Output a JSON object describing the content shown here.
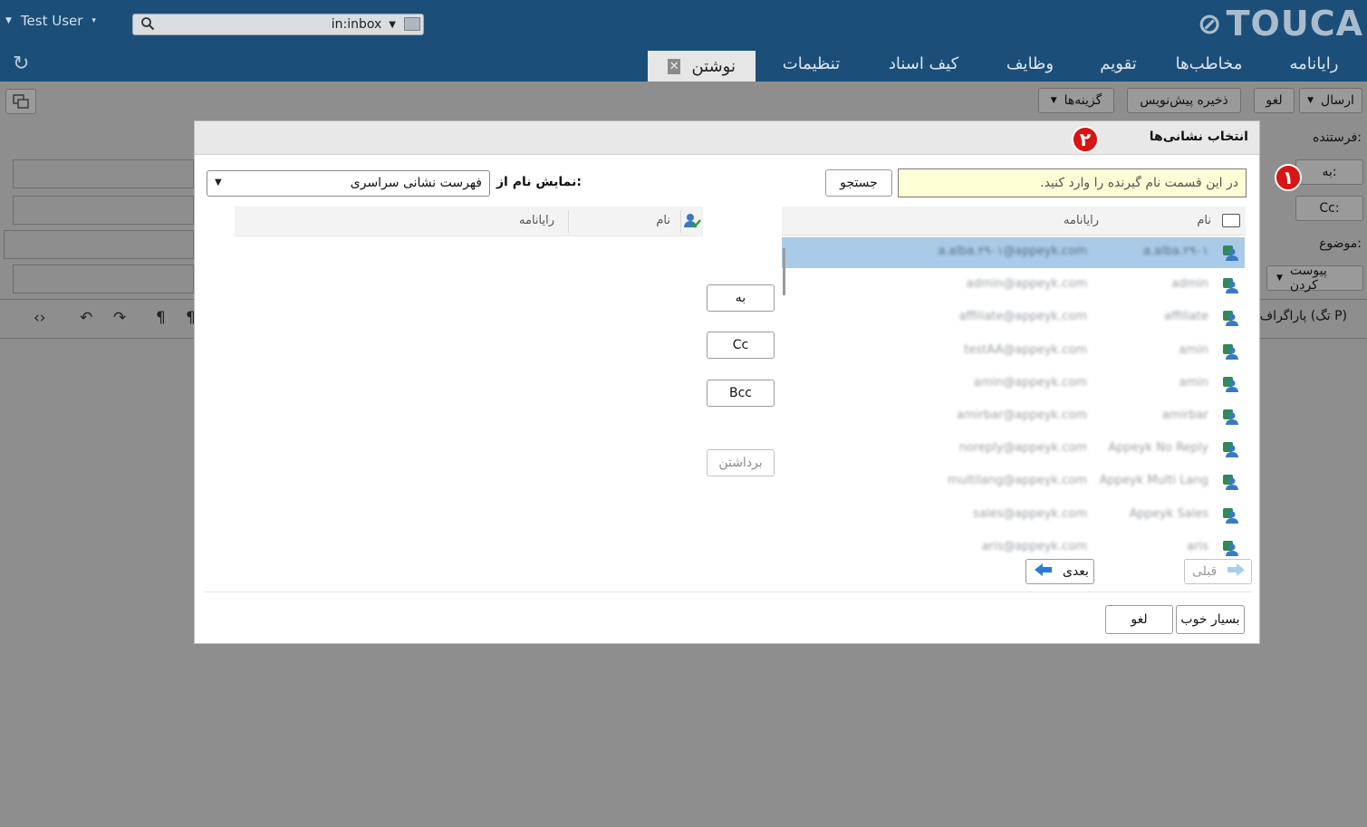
{
  "topbar": {
    "user_name": "Test User",
    "search_query": "",
    "search_scope": "in:inbox",
    "logo": "TOUCA",
    "tabs": [
      {
        "label": "رایانامه"
      },
      {
        "label": "مخاطب‌ها"
      },
      {
        "label": "تقویم"
      },
      {
        "label": "وظایف"
      },
      {
        "label": "کیف اسناد"
      },
      {
        "label": "تنظیمات"
      },
      {
        "label": "نوشتن",
        "active": true
      }
    ]
  },
  "compose": {
    "send_label": "ارسال",
    "cancel_label": "لغو",
    "save_draft_label": "ذخیره پیش‌نویس",
    "options_label": "گزینه‌ها",
    "from_label": "فرستنده:",
    "to_label": "به:",
    "cc_label": "Cc:",
    "subject_label": "موضوع:",
    "attach_label": "پیوست کردن",
    "paragraph_label": "پاراگراف (تگ P)"
  },
  "steps": {
    "one": "۱",
    "two": "۲"
  },
  "dialog": {
    "title": "انتخاب نشانی‌ها",
    "search_placeholder": "در این قسمت نام گیرنده را وارد کنید.",
    "search_button": "جستجو",
    "show_names_from_label": "نمایش نام از:",
    "source_selected": "فهرست نشانی سراسری",
    "results_columns": {
      "name": "نام",
      "email": "رایانامه"
    },
    "results": [
      {
        "name": "a.alba.۲۹۰۱",
        "email": "a.alba.۲۹۰۱@appeyk.com",
        "selected": true
      },
      {
        "name": "admin",
        "email": "admin@appeyk.com"
      },
      {
        "name": "affiliate",
        "email": "affiliate@appeyk.com"
      },
      {
        "name": "amin",
        "email": "testAA@appeyk.com"
      },
      {
        "name": "amin",
        "email": "amin@appeyk.com"
      },
      {
        "name": "amirbar",
        "email": "amirbar@appeyk.com"
      },
      {
        "name": "Appeyk No Reply",
        "email": "noreply@appeyk.com"
      },
      {
        "name": "Appeyk Multi Lang",
        "email": "multilang@appeyk.com"
      },
      {
        "name": "Appeyk Sales",
        "email": "sales@appeyk.com"
      },
      {
        "name": "aris",
        "email": "aris@appeyk.com"
      }
    ],
    "add_to_label": "به",
    "add_cc_label": "Cc",
    "add_bcc_label": "Bcc",
    "remove_label": "برداشتن",
    "selected_columns": {
      "name": "نام",
      "email": "رایانامه"
    },
    "prev_label": "قبلی",
    "next_label": "بعدی",
    "ok_label": "بسیار خوب",
    "cancel_label": "لغو"
  },
  "colors": {
    "header": "#1b4e78",
    "selection": "#a9cbe8",
    "step_badge": "#d81414"
  }
}
